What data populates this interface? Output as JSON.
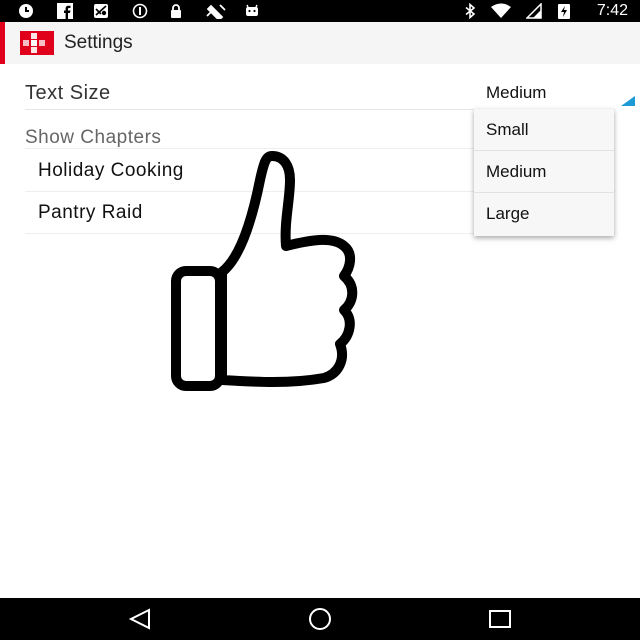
{
  "status_bar": {
    "time": "7:42",
    "left_icons": [
      "clock-icon",
      "facebook-icon",
      "maps-icon",
      "circle-info-icon",
      "lock-icon",
      "satellite-icon",
      "android-icon"
    ],
    "right_icons": [
      "bluetooth-icon",
      "wifi-icon",
      "signal-icon",
      "battery-charging-icon"
    ]
  },
  "app_bar": {
    "title": "Settings",
    "logo_icon": "flipboard-logo-icon",
    "accent_color": "#e0001b"
  },
  "settings": {
    "text_size": {
      "label": "Text Size",
      "selected": "Medium",
      "accent_color": "#1e9ad6"
    },
    "show_chapters": {
      "header": "Show Chapters",
      "items": [
        {
          "label": "Holiday Cooking"
        },
        {
          "label": "Pantry Raid"
        }
      ]
    }
  },
  "dropdown": {
    "options": [
      {
        "label": "Small"
      },
      {
        "label": "Medium"
      },
      {
        "label": "Large"
      }
    ]
  },
  "overlay": {
    "icon": "thumbs-up-icon"
  },
  "nav_bar": {
    "buttons": [
      "back-icon",
      "home-icon",
      "recents-icon"
    ]
  }
}
